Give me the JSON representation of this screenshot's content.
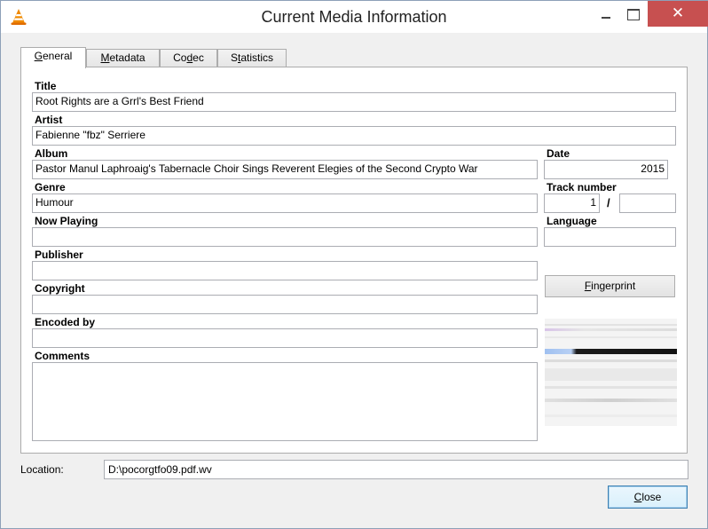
{
  "window": {
    "title": "Current Media Information",
    "app_icon": "vlc-cone-icon",
    "controls": {
      "minimize": "minimize-icon",
      "maximize": "maximize-icon",
      "close": "✕"
    }
  },
  "tabs": [
    {
      "label_pre": "",
      "label_u": "G",
      "label_post": "eneral",
      "active": true
    },
    {
      "label_pre": "",
      "label_u": "M",
      "label_post": "etadata",
      "active": false
    },
    {
      "label_pre": "Co",
      "label_u": "d",
      "label_post": "ec",
      "active": false
    },
    {
      "label_pre": "S",
      "label_u": "t",
      "label_post": "atistics",
      "active": false
    }
  ],
  "general": {
    "title": {
      "label": "Title",
      "value": "Root Rights are a Grrl's Best Friend"
    },
    "artist": {
      "label": "Artist",
      "value": "Fabienne \"fbz\" Serriere"
    },
    "album": {
      "label": "Album",
      "value": "Pastor Manul Laphroaig's Tabernacle Choir Sings Reverent Elegies of the Second Crypto War"
    },
    "date": {
      "label": "Date",
      "value": "2015"
    },
    "genre": {
      "label": "Genre",
      "value": "Humour"
    },
    "track_number": {
      "label": "Track number",
      "value": "1",
      "separator": "/",
      "total": ""
    },
    "now_playing": {
      "label": "Now Playing",
      "value": ""
    },
    "language": {
      "label": "Language",
      "value": ""
    },
    "publisher": {
      "label": "Publisher",
      "value": ""
    },
    "copyright": {
      "label": "Copyright",
      "value": ""
    },
    "encoded_by": {
      "label": "Encoded by",
      "value": ""
    },
    "comments": {
      "label": "Comments",
      "value": ""
    },
    "fingerprint_button": {
      "pre": "",
      "u": "F",
      "post": "ingerprint"
    }
  },
  "location": {
    "label": "Location:",
    "value": "D:\\pocorgtfo09.pdf.wv"
  },
  "close_button": {
    "pre": "",
    "u": "C",
    "post": "lose"
  },
  "colors": {
    "close_hover": "#c75050",
    "default_button_border": "#3c7fb1",
    "field_border": "#abadb3"
  }
}
